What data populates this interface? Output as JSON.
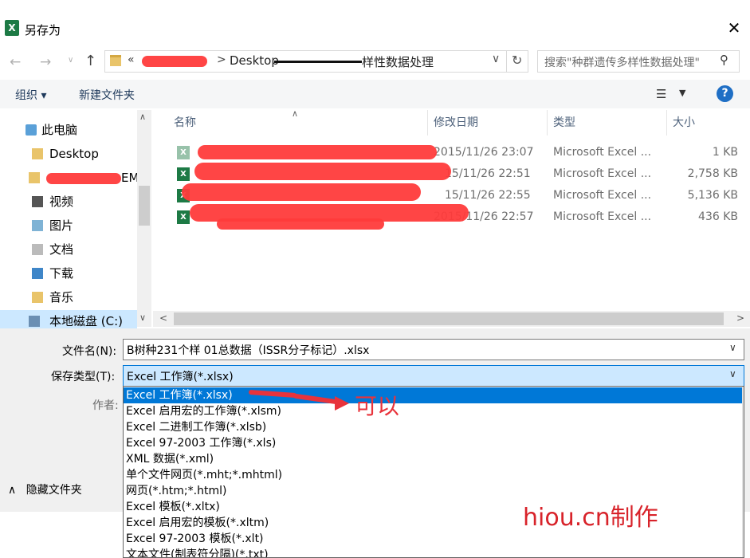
{
  "window": {
    "title": "另存为",
    "close": "✕"
  },
  "nav": {
    "address_desktop": "Desktop",
    "address_path": "样性数据处理",
    "address_prefix": "«",
    "search_placeholder": "搜索\"种群遗传多样性数据处理\""
  },
  "toolbar": {
    "organize": "组织 ▾",
    "new_folder": "新建文件夹",
    "help": "?"
  },
  "sidebar": {
    "items": [
      {
        "label": "此电脑"
      },
      {
        "label": "Desktop"
      },
      {
        "label": "EM"
      },
      {
        "label": "视频"
      },
      {
        "label": "图片"
      },
      {
        "label": "文档"
      },
      {
        "label": "下载"
      },
      {
        "label": "音乐"
      },
      {
        "label": "本地磁盘 (C:)"
      }
    ]
  },
  "columns": {
    "name": "名称",
    "modified": "修改日期",
    "type": "类型",
    "size": "大小"
  },
  "files": [
    {
      "modified": "2015/11/26 23:07",
      "type": "Microsoft Excel ...",
      "size": "1 KB"
    },
    {
      "modified": "15/11/26 22:51",
      "type": "Microsoft Excel ...",
      "size": "2,758 KB"
    },
    {
      "modified": "15/11/26 22:55",
      "type": "Microsoft Excel ...",
      "size": "5,136 KB"
    },
    {
      "modified": "2015/11/26 22:57",
      "type": "Microsoft Excel ...",
      "size": "436 KB"
    }
  ],
  "form": {
    "filename_label": "文件名(N):",
    "filename_value": "B树种231个样 01总数据（ISSR分子标记）.xlsx",
    "filetype_label": "保存类型(T):",
    "filetype_value": "Excel 工作簿(*.xlsx)",
    "author_label": "作者:",
    "hide_folders": "隐藏文件夹"
  },
  "filetype_options": [
    "Excel 工作簿(*.xlsx)",
    "Excel 启用宏的工作簿(*.xlsm)",
    "Excel 二进制工作簿(*.xlsb)",
    "Excel 97-2003 工作簿(*.xls)",
    "XML 数据(*.xml)",
    "单个文件网页(*.mht;*.mhtml)",
    "网页(*.htm;*.html)",
    "Excel 模板(*.xltx)",
    "Excel 启用宏的模板(*.xltm)",
    "Excel 97-2003 模板(*.xlt)",
    "文本文件(制表符分隔)(*.txt)"
  ],
  "annotations": {
    "ok_note": "可以",
    "watermark": "hiou.cn制作"
  },
  "colors": {
    "selection": "#0078d7",
    "highlight": "#cce8ff",
    "redaction": "#ff3b3b"
  }
}
